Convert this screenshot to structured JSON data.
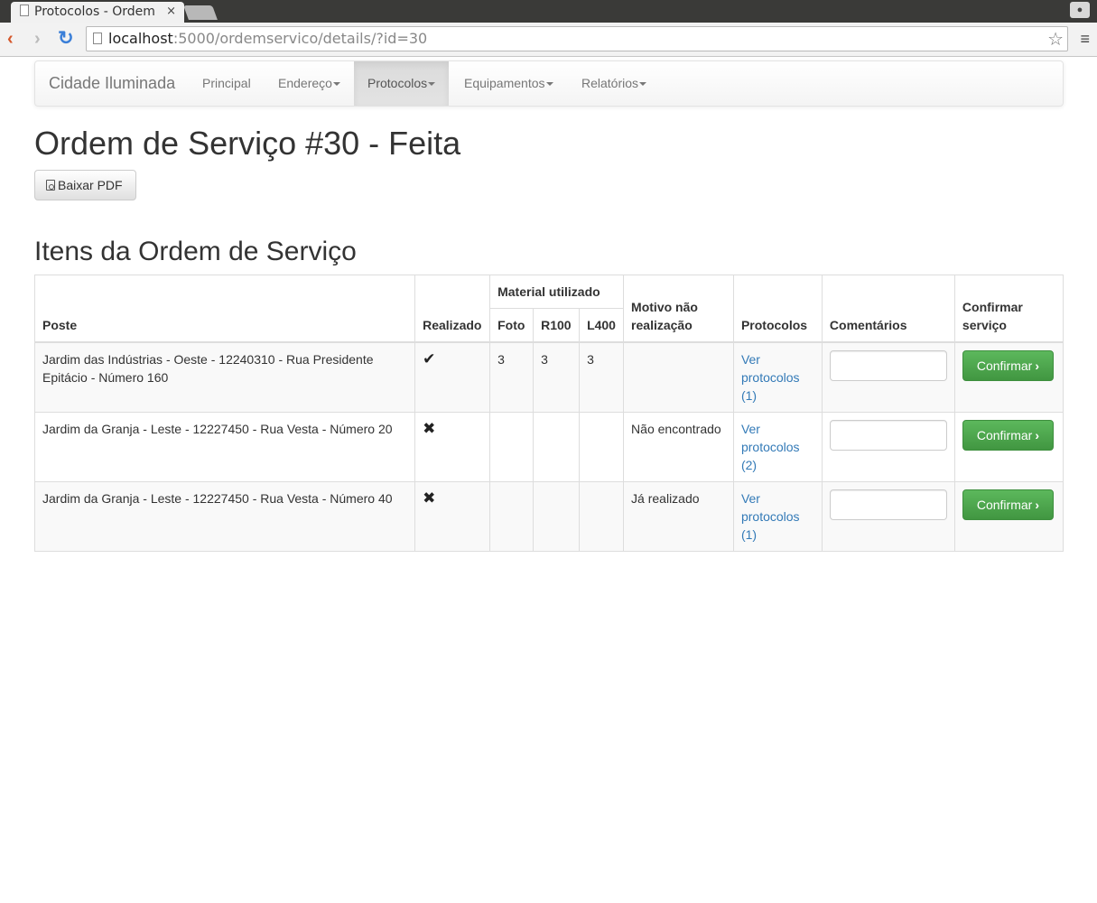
{
  "browser": {
    "tab_title": "Protocolos - Ordem",
    "tab_close": "×",
    "url_host": "localhost",
    "url_path": ":5000/ordemservico/details/?id=30"
  },
  "navbar": {
    "brand": "Cidade Iluminada",
    "items": [
      {
        "label": "Principal",
        "dropdown": false
      },
      {
        "label": "Endereço",
        "dropdown": true
      },
      {
        "label": "Protocolos",
        "dropdown": true,
        "active": true
      },
      {
        "label": "Equipamentos",
        "dropdown": true
      },
      {
        "label": "Relatórios",
        "dropdown": true
      }
    ]
  },
  "page": {
    "title": "Ordem de Serviço #30 - Feita",
    "pdf_button": "Baixar PDF",
    "section_title": "Itens da Ordem de Serviço"
  },
  "table": {
    "headers": {
      "poste": "Poste",
      "realizado": "Realizado",
      "material": "Material utilizado",
      "foto": "Foto",
      "r100": "R100",
      "l400": "L400",
      "motivo": "Motivo não realização",
      "protocolos": "Protocolos",
      "comentarios": "Comentários",
      "confirmar": "Confirmar serviço"
    },
    "rows": [
      {
        "poste": "Jardim das Indústrias - Oeste - 12240310 - Rua Presidente Epitácio - Número 160",
        "realizado": "✔",
        "foto": "3",
        "r100": "3",
        "l400": "3",
        "motivo": "",
        "protocolos_link": "Ver protocolos (1)",
        "comentario": "",
        "confirm_label": "Confirmar"
      },
      {
        "poste": "Jardim da Granja - Leste - 12227450 - Rua Vesta - Número 20",
        "realizado": "✖",
        "foto": "",
        "r100": "",
        "l400": "",
        "motivo": "Não encontrado",
        "protocolos_link": "Ver protocolos (2)",
        "comentario": "",
        "confirm_label": "Confirmar"
      },
      {
        "poste": "Jardim da Granja - Leste - 12227450 - Rua Vesta - Número 40",
        "realizado": "✖",
        "foto": "",
        "r100": "",
        "l400": "",
        "motivo": "Já realizado",
        "protocolos_link": "Ver protocolos (1)",
        "comentario": "",
        "confirm_label": "Confirmar"
      }
    ]
  },
  "icons": {
    "back": "‹",
    "forward": "›",
    "reload": "↻",
    "star": "☆",
    "menu": "≡",
    "chevron": "›"
  },
  "colors": {
    "link": "#337ab7",
    "success": "#5cb85c",
    "navbar_active": "#e3e3e3"
  }
}
